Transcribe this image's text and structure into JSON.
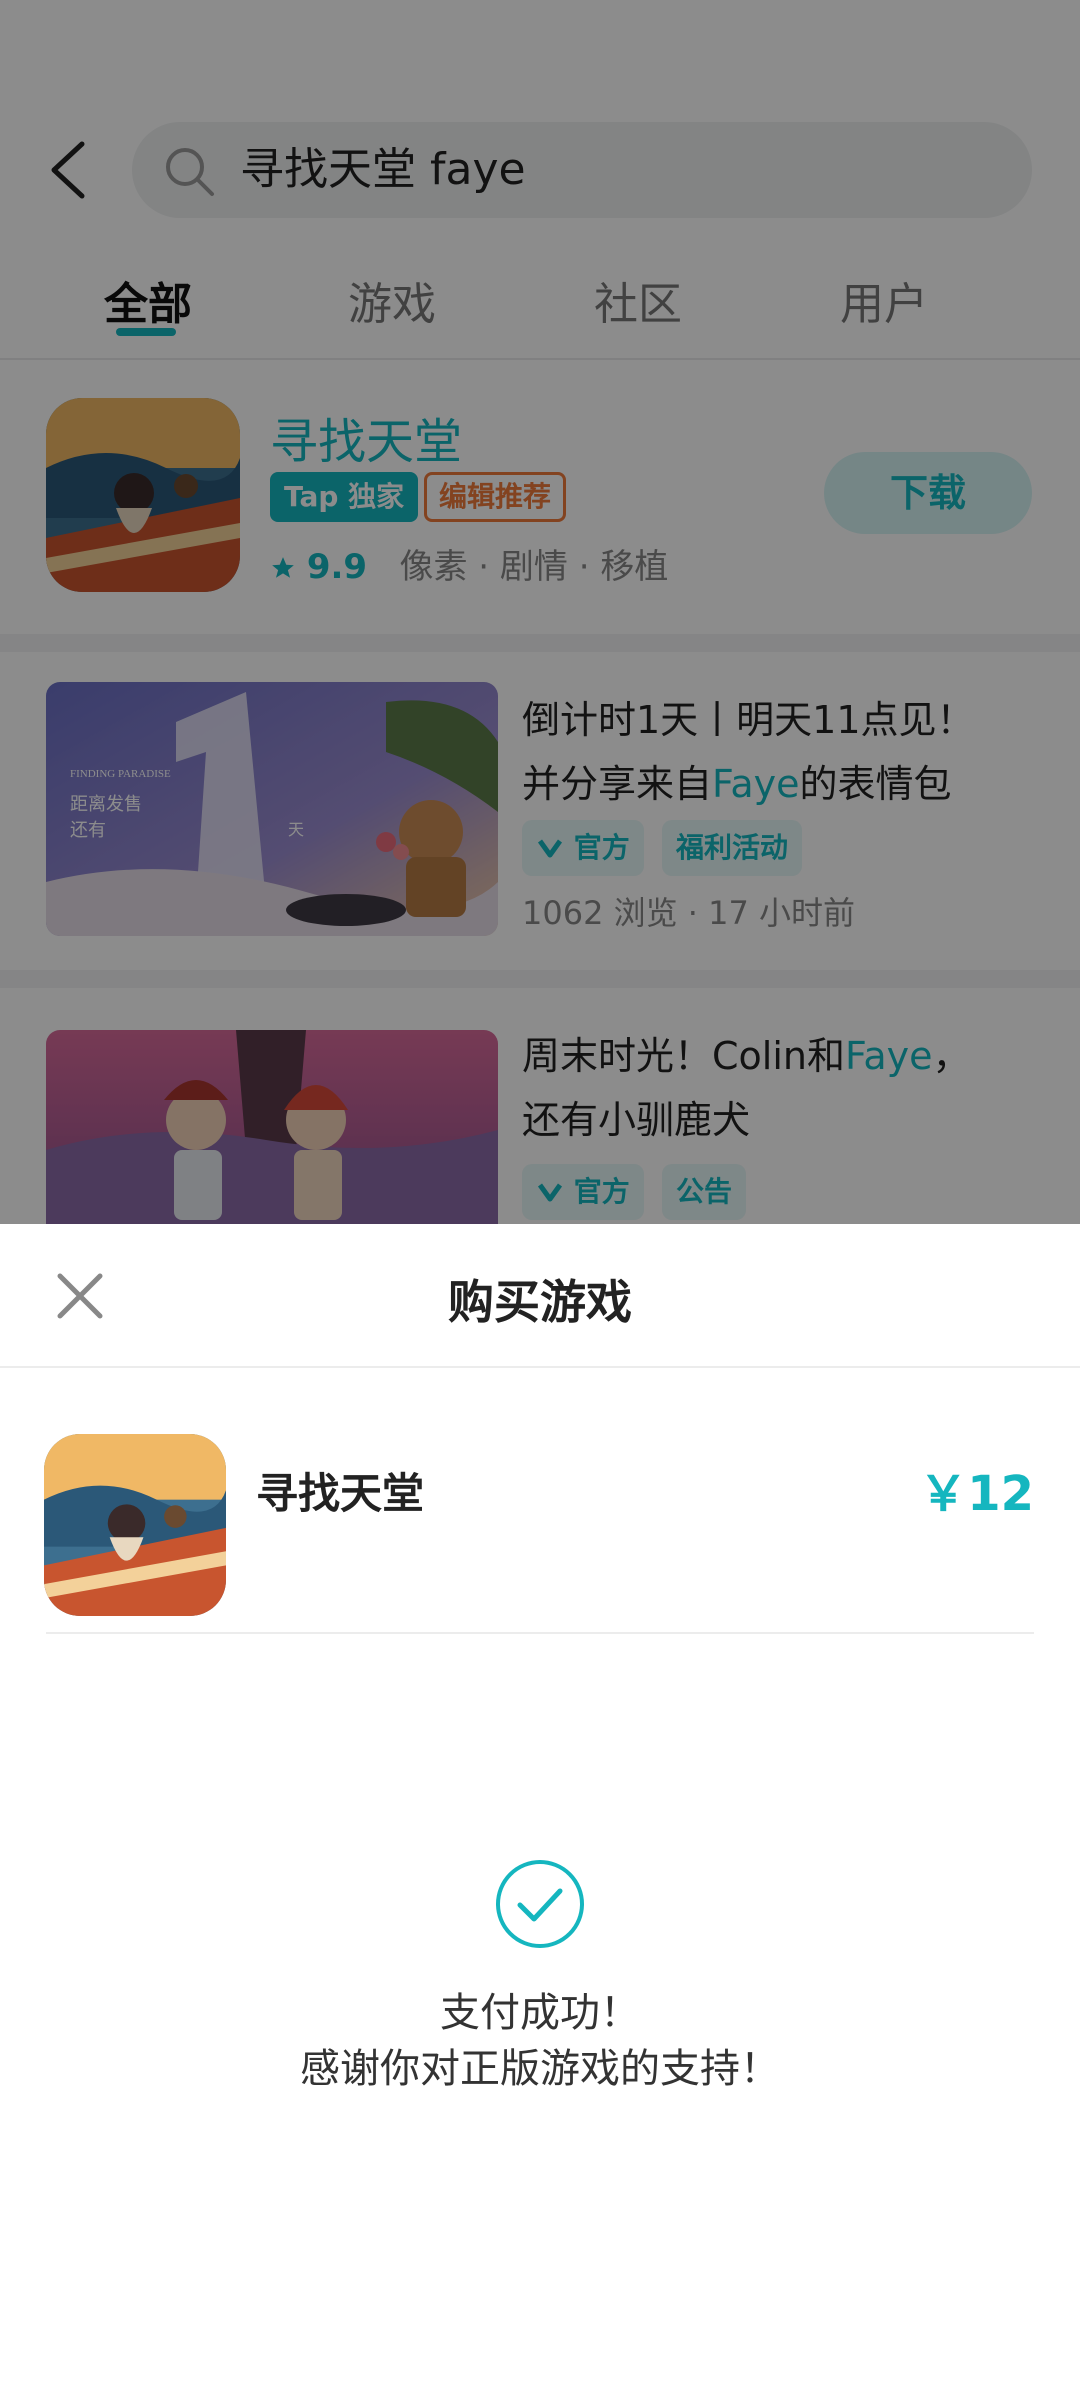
{
  "search": {
    "query": "寻找天堂 faye"
  },
  "tabs": [
    {
      "label": "全部",
      "active": true
    },
    {
      "label": "游戏",
      "active": false
    },
    {
      "label": "社区",
      "active": false
    },
    {
      "label": "用户",
      "active": false
    }
  ],
  "game": {
    "title": "寻找天堂",
    "badge_tap": "Tap 独家",
    "badge_editor": "编辑推荐",
    "rating": "9.9",
    "tags": "像素 · 剧情 · 移植",
    "download_label": "下载"
  },
  "posts": [
    {
      "title_line1": "倒计时1天丨明天11点见！",
      "title_line2_pre": "并分享来自",
      "title_line2_hl": "Faye",
      "title_line2_post": "的表情包",
      "tag1": "官方",
      "tag2": "福利活动",
      "meta": "1062 浏览 · 17 小时前",
      "thumb_text_1": "FINDING PARADISE",
      "thumb_text_2": "距离发售",
      "thumb_text_3": "还有",
      "thumb_text_4": "天"
    },
    {
      "title_line1_pre": "周末时光！Colin和",
      "title_line1_hl": "Faye",
      "title_line1_post": "，",
      "title_line2": "还有小驯鹿犬",
      "tag1": "官方",
      "tag2": "公告"
    }
  ],
  "sheet": {
    "title": "购买游戏",
    "game_name": "寻找天堂",
    "price": "￥12",
    "success_line1": "支付成功！",
    "success_line2": "感谢你对正版游戏的支持！"
  },
  "colors": {
    "accent": "#15b6bf",
    "editor_badge": "#ef7a3b"
  }
}
